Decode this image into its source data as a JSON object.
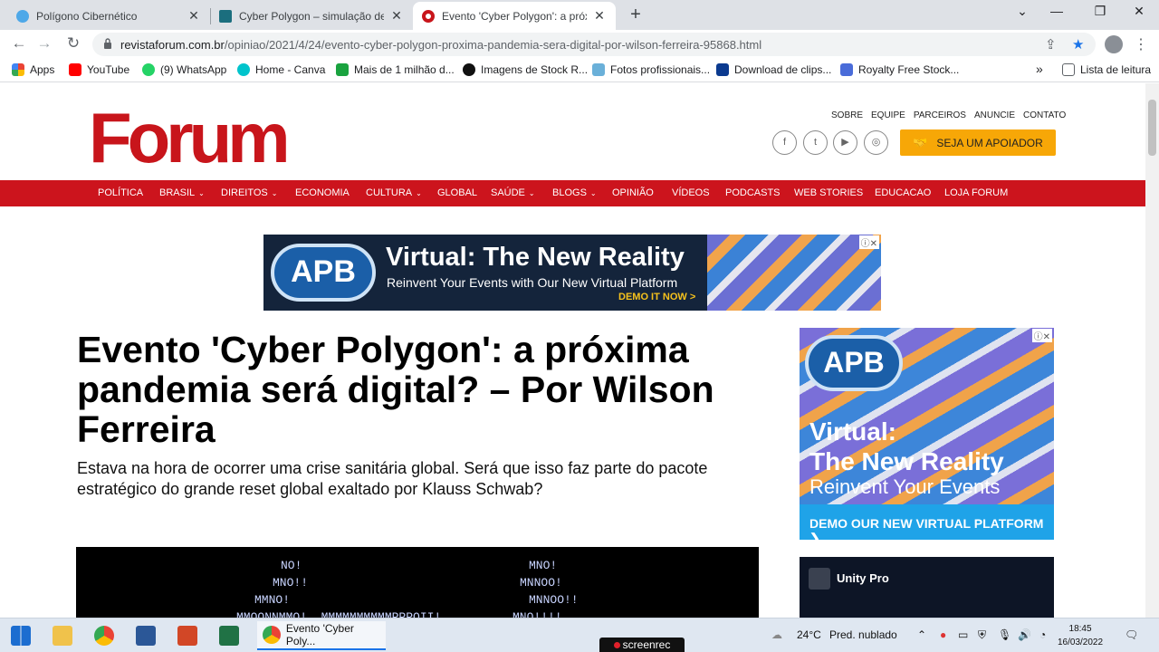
{
  "browser": {
    "tabs": [
      {
        "title": "Polígono Cibernético",
        "active": false
      },
      {
        "title": "Cyber Polygon – simulação de 'p",
        "active": false
      },
      {
        "title": "Evento 'Cyber Polygon': a próxim",
        "active": true
      }
    ],
    "new_tab": "+",
    "url_host": "revistaforum.com.br",
    "url_path": "/opiniao/2021/4/24/evento-cyber-polygon-proxima-pandemia-sera-digital-por-wilson-ferreira-95868.html",
    "bookmarks": [
      {
        "label": "Apps",
        "color": "#4285f4"
      },
      {
        "label": "YouTube",
        "color": "#ff0000"
      },
      {
        "label": "(9) WhatsApp",
        "color": "#25d366"
      },
      {
        "label": "Home - Canva",
        "color": "#00c4cc"
      },
      {
        "label": "Mais de 1 milhão d...",
        "color": "#1aa33f"
      },
      {
        "label": "Imagens de Stock R...",
        "color": "#111111"
      },
      {
        "label": "Fotos profissionais...",
        "color": "#6ab0d9"
      },
      {
        "label": "Download de clips...",
        "color": "#0b3a8f"
      },
      {
        "label": "Royalty Free Stock...",
        "color": "#4a6cd9"
      }
    ],
    "more_bookmarks": "»",
    "reading_list": "Lista de leitura"
  },
  "site": {
    "logo": "Forum",
    "top_links": [
      "SOBRE",
      "EQUIPE",
      "PARCEIROS",
      "ANUNCIE",
      "CONTATO"
    ],
    "social": [
      "f",
      "t",
      "▶",
      "◎"
    ],
    "support_button": "SEJA UM APOIADOR",
    "nav": [
      {
        "label": "POLÍTICA",
        "dropdown": false
      },
      {
        "label": "BRASIL",
        "dropdown": true
      },
      {
        "label": "DIREITOS",
        "dropdown": true
      },
      {
        "label": "ECONOMIA",
        "dropdown": false
      },
      {
        "label": "CULTURA",
        "dropdown": true
      },
      {
        "label": "GLOBAL",
        "dropdown": false
      },
      {
        "label": "SAÚDE",
        "dropdown": true
      },
      {
        "label": "BLOGS",
        "dropdown": true
      },
      {
        "label": "OPINIÃO",
        "dropdown": false
      },
      {
        "label": "VÍDEOS",
        "dropdown": false
      },
      {
        "label": "PODCASTS",
        "dropdown": false
      },
      {
        "label": "WEB STORIES",
        "dropdown": false
      },
      {
        "label": "EDUCACAO",
        "dropdown": false
      },
      {
        "label": "LOJA FORUM",
        "dropdown": false
      }
    ]
  },
  "ad_banner": {
    "logo": "APB",
    "headline": "Virtual: The New Reality",
    "subline": "Reinvent Your Events with Our New Virtual Platform",
    "cta": "DEMO IT NOW >"
  },
  "article": {
    "headline": "Evento 'Cyber Polygon': a próxima pandemia será digital? – Por Wilson Ferreira",
    "subtitle": "Estava na hora de ocorrer uma crise sanitária global. Será que isso faz parte do pacote estratégico do grande reset global exaltado por Klauss Schwab?",
    "ascii_lines": [
      "NO!",
      "MNO!!",
      "MMNO!",
      "MMOONNMMO!  MMMMMMMMMMPPPOII!",
      "MNO!",
      "MNNOO!",
      "MNNOO!!",
      "MNO!!!!"
    ]
  },
  "side_ad": {
    "logo": "APB",
    "headline_1": "Virtual:",
    "headline_2": "The New Reality",
    "subline": "Reinvent Your Events",
    "cta": "DEMO OUR NEW VIRTUAL PLATFORM ❯"
  },
  "side_ad_2": {
    "title": "Unity Pro"
  },
  "taskbar": {
    "active_app": "Evento 'Cyber Poly...",
    "weather_temp": "24°C",
    "weather_desc": "Pred. nublado",
    "time": "18:45",
    "date": "16/03/2022",
    "recorder": "screenrec"
  }
}
